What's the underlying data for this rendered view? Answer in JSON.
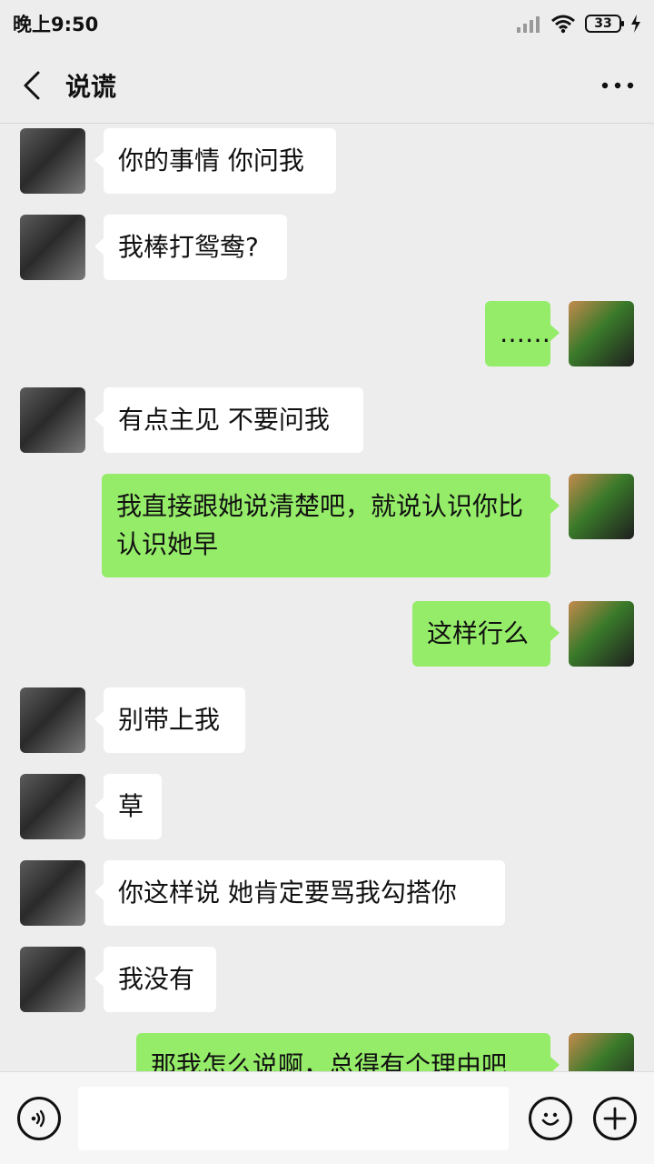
{
  "status_bar": {
    "time": "晚上9:50",
    "battery": "33"
  },
  "header": {
    "title": "说谎"
  },
  "messages": [
    {
      "side": "left",
      "text": "你的事情 你问我"
    },
    {
      "side": "left",
      "text": "我棒打鸳鸯?"
    },
    {
      "side": "right",
      "text": "……"
    },
    {
      "side": "left",
      "text": "有点主见 不要问我"
    },
    {
      "side": "right",
      "text": "我直接跟她说清楚吧，就说认识你比认识她早"
    },
    {
      "side": "right",
      "text": "这样行么"
    },
    {
      "side": "left",
      "text": "别带上我"
    },
    {
      "side": "left",
      "text": "草"
    },
    {
      "side": "left",
      "text": "你这样说 她肯定要骂我勾搭你"
    },
    {
      "side": "left",
      "text": "我没有"
    },
    {
      "side": "right",
      "text": "那我怎么说啊，总得有个理由吧"
    }
  ],
  "input": {
    "value": ""
  },
  "icons": {
    "back": "chevron-left-icon",
    "more": "more-dots-icon",
    "voice": "voice-icon",
    "emoji": "emoji-icon",
    "add": "plus-icon"
  }
}
